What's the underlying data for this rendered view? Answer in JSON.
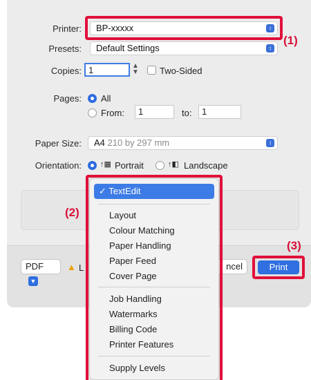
{
  "printer": {
    "label": "Printer:",
    "value": "BP-xxxxx"
  },
  "presets": {
    "label": "Presets:",
    "value": "Default Settings"
  },
  "copies": {
    "label": "Copies:",
    "value": "1",
    "two_sided_label": "Two-Sided"
  },
  "pages": {
    "label": "Pages:",
    "all_label": "All",
    "from_label": "From:",
    "from_value": "1",
    "to_label": "to:",
    "to_value": "1"
  },
  "paper_size": {
    "label": "Paper Size:",
    "value": "A4",
    "detail": "210 by 297 mm"
  },
  "orientation": {
    "label": "Orientation:",
    "portrait_label": "Portrait",
    "landscape_label": "Landscape"
  },
  "bottom": {
    "pdf_label": "PDF",
    "warning_partial": "L",
    "cancel_partial": "ncel",
    "print_label": "Print"
  },
  "menu": {
    "selected": "TextEdit",
    "items": [
      "Layout",
      "Colour Matching",
      "Paper Handling",
      "Paper Feed",
      "Cover Page",
      "Job Handling",
      "Watermarks",
      "Billing Code",
      "Printer Features",
      "Supply Levels"
    ]
  },
  "callouts": {
    "c1": "(1)",
    "c2": "(2)",
    "c3": "(3)"
  },
  "colors": {
    "highlight": "#e0103a",
    "accent": "#2f6fe0"
  }
}
